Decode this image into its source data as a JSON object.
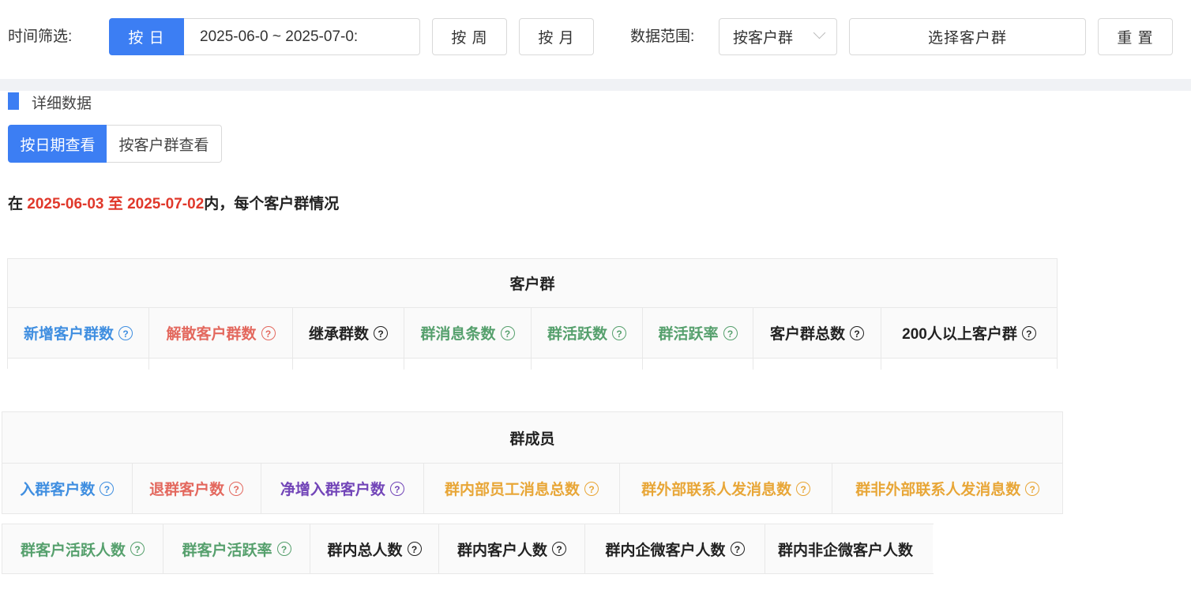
{
  "filter": {
    "time_label": "时间筛选:",
    "by_day": "按 日",
    "date_range": "2025-06-0 ~ 2025-07-0:",
    "by_week": "按 周",
    "by_month": "按 月",
    "scope_label": "数据范围:",
    "scope_select": "按客户群",
    "choose_group": "选择客户群",
    "reset": "重 置"
  },
  "detail": {
    "title": "详细数据",
    "view_by_date": "按日期查看",
    "view_by_group": "按客户群查看"
  },
  "summary": {
    "prefix": "在",
    "start": "2025-06-03",
    "middle": "至",
    "end": "2025-07-02",
    "suffix": "内，每个客户群情况"
  },
  "table1": {
    "title": "客户群",
    "columns": [
      {
        "label": "新增客户群数",
        "color": "#3f8ee0"
      },
      {
        "label": "解散客户群数",
        "color": "#e3685e"
      },
      {
        "label": "继承群数",
        "color": "#222222"
      },
      {
        "label": "群消息条数",
        "color": "#56a06d"
      },
      {
        "label": "群活跃数",
        "color": "#56a06d"
      },
      {
        "label": "群活跃率",
        "color": "#56a06d"
      },
      {
        "label": "客户群总数",
        "color": "#222222"
      },
      {
        "label": "200人以上客户群",
        "color": "#222222"
      }
    ]
  },
  "table2": {
    "title": "群成员",
    "columns": [
      {
        "label": "入群客户数",
        "color": "#3f8ee0"
      },
      {
        "label": "退群客户数",
        "color": "#e3685e"
      },
      {
        "label": "净增入群客户数",
        "color": "#7245b8"
      },
      {
        "label": "群内部员工消息总数",
        "color": "#e8a637"
      },
      {
        "label": "群外部联系人发消息数",
        "color": "#e8a637"
      },
      {
        "label": "群非外部联系人发消息数",
        "color": "#e8a637"
      }
    ]
  },
  "table3": {
    "columns": [
      {
        "label": "群客户活跃人数",
        "color": "#56a06d"
      },
      {
        "label": "群客户活跃率",
        "color": "#56a06d"
      },
      {
        "label": "群内总人数",
        "color": "#222222"
      },
      {
        "label": "群内客户人数",
        "color": "#222222"
      },
      {
        "label": "群内企微客户人数",
        "color": "#222222"
      },
      {
        "label": "群内非企微客户人数",
        "color": "#222222"
      }
    ]
  },
  "help_icon": "question-circle-icon"
}
